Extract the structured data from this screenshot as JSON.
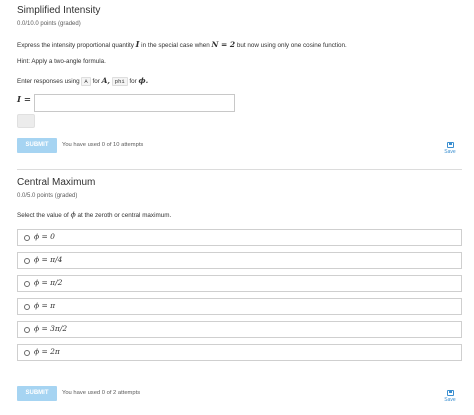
{
  "problem1": {
    "title": "Simplified Intensity",
    "points": "0.0/10.0 points (graded)",
    "prompt_parts": [
      "Express the intensity proportional quantity",
      "I",
      "in the special case when",
      "N = 2",
      "but now using only one cosine function."
    ],
    "hint": "Hint: Apply a two-angle formula.",
    "enter_parts": [
      "Enter responses using",
      "A",
      "for",
      "A,",
      "phi",
      "for",
      "ϕ."
    ],
    "input_label": "I =",
    "input_value": "",
    "submit_label": "SUBMIT",
    "attempts": "You have used 0 of 10 attempts",
    "save_label": "Save"
  },
  "problem2": {
    "title": "Central Maximum",
    "points": "0.0/5.0 points (graded)",
    "prompt_parts": [
      "Select the value of",
      "ϕ",
      "at the zeroth or central maximum."
    ],
    "choices": [
      "ϕ = 0",
      "ϕ = π/4",
      "ϕ = π/2",
      "ϕ = π",
      "ϕ = 3π/2",
      "ϕ = 2π"
    ],
    "submit_label": "SUBMIT",
    "attempts": "You have used 0 of 2 attempts",
    "save_label": "Save"
  },
  "colors": {
    "submit_bg": "#a6d4f2",
    "save_accent": "#3b8fd0"
  }
}
